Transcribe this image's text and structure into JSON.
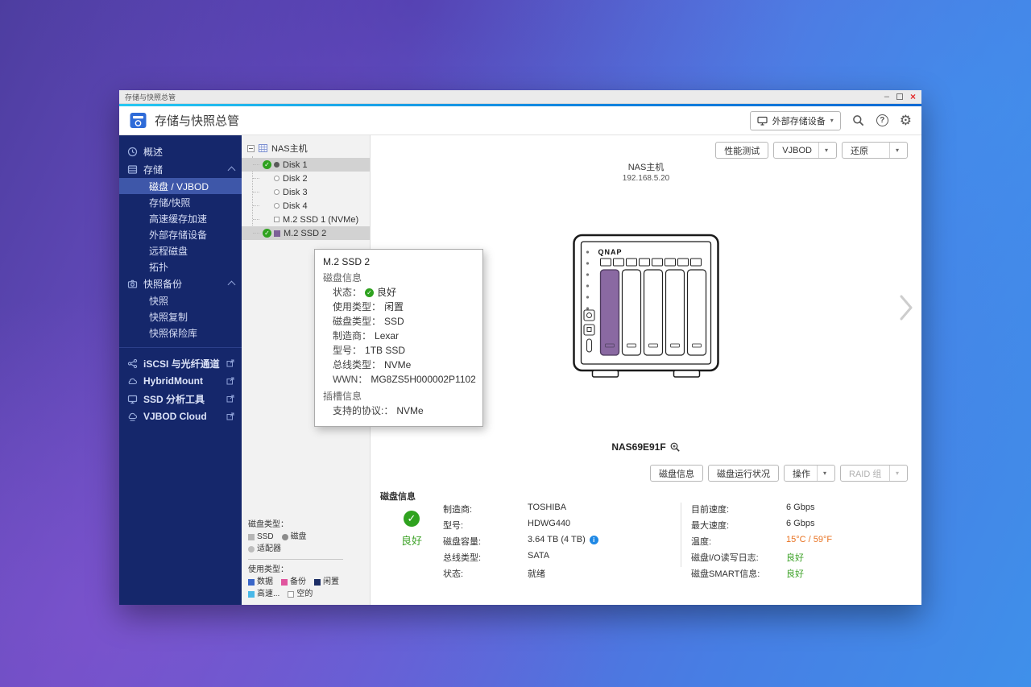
{
  "titlebar": {
    "title": "存储与快照总管"
  },
  "icons": {
    "minimize": "–",
    "close": "×",
    "dropdown": "▾",
    "help": "?",
    "gear": "⚙",
    "info": "i"
  },
  "header": {
    "app_title": "存储与快照总管",
    "external_storage_button": "外部存储设备"
  },
  "sidebar": {
    "items": [
      {
        "label": "概述"
      },
      {
        "label": "存储"
      },
      {
        "label": "磁盘 / VJBOD"
      },
      {
        "label": "存储/快照"
      },
      {
        "label": "高速缓存加速"
      },
      {
        "label": "外部存储设备"
      },
      {
        "label": "远程磁盘"
      },
      {
        "label": "拓扑"
      },
      {
        "label": "快照备份"
      },
      {
        "label": "快照"
      },
      {
        "label": "快照复制"
      },
      {
        "label": "快照保险库"
      },
      {
        "label": "iSCSI 与光纤通道"
      },
      {
        "label": "HybridMount"
      },
      {
        "label": "SSD 分析工具"
      },
      {
        "label": "VJBOD Cloud"
      }
    ]
  },
  "tree": {
    "root": "NAS主机",
    "items": [
      {
        "label": "Disk 1"
      },
      {
        "label": "Disk 2"
      },
      {
        "label": "Disk 3"
      },
      {
        "label": "Disk 4"
      },
      {
        "label": "M.2 SSD 1 (NVMe)"
      },
      {
        "label": "M.2 SSD 2"
      }
    ],
    "legend": {
      "disk_type_label": "磁盘类型：",
      "disk_types": [
        "SSD",
        "磁盘",
        "适配器"
      ],
      "usage_type_label": "使用类型：",
      "usage_types": [
        "数据",
        "备份",
        "闲置",
        "高速...",
        "空的"
      ]
    }
  },
  "tooltip": {
    "title": "M.2 SSD 2",
    "disk_info_label": "磁盘信息",
    "rows": [
      {
        "label": "状态：",
        "value": "良好"
      },
      {
        "label": "使用类型：",
        "value": "闲置"
      },
      {
        "label": "磁盘类型：",
        "value": "SSD"
      },
      {
        "label": "制造商：",
        "value": "Lexar"
      },
      {
        "label": "型号：",
        "value": "1TB SSD"
      },
      {
        "label": "总线类型：",
        "value": "NVMe"
      },
      {
        "label": "WWN：",
        "value": "MG8ZS5H000002P1102"
      }
    ],
    "slot_info_label": "插槽信息",
    "slot_rows": [
      {
        "label": "支持的协议:：",
        "value": "NVMe"
      }
    ]
  },
  "main": {
    "toolbar": {
      "performance_test": "性能测试",
      "vjbod": "VJBOD",
      "restore": "还原"
    },
    "host": {
      "name": "NAS主机",
      "ip": "192.168.5.20"
    },
    "device": {
      "brand": "QNAP",
      "id": "NAS69E91F"
    },
    "actions": {
      "disk_info": "磁盘信息",
      "disk_health": "磁盘运行状况",
      "operation": "操作",
      "raid_group": "RAID 组"
    },
    "disk_info": {
      "section_title": "磁盘信息",
      "status": "良好",
      "left_rows": [
        {
          "label": "制造商:",
          "value": "TOSHIBA"
        },
        {
          "label": "型号:",
          "value": "HDWG440"
        },
        {
          "label": "磁盘容量:",
          "value": "3.64 TB (4 TB)"
        },
        {
          "label": "总线类型:",
          "value": "SATA"
        },
        {
          "label": "状态:",
          "value": "就绪"
        }
      ],
      "right_rows": [
        {
          "label": "目前速度:",
          "value": "6 Gbps"
        },
        {
          "label": "最大速度:",
          "value": "6 Gbps"
        },
        {
          "label": "温度:",
          "value": "15°C / 59°F"
        },
        {
          "label": "磁盘I/O读写日志:",
          "value": "良好"
        },
        {
          "label": "磁盘SMART信息:",
          "value": "良好"
        }
      ]
    }
  },
  "colors": {
    "good_green": "#2fa21f",
    "temperature_orange": "#e87120",
    "bay_purple": "#7d5f98",
    "legend_data_blue": "#3a66c8",
    "legend_backup_pink": "#e0559e",
    "legend_idle_navy": "#1d2e66",
    "legend_cache_blue": "#49b8e8",
    "sidebar_blue": "#15276b",
    "selected_blue": "#3e57a9",
    "accent_blue": "#1186e0"
  }
}
